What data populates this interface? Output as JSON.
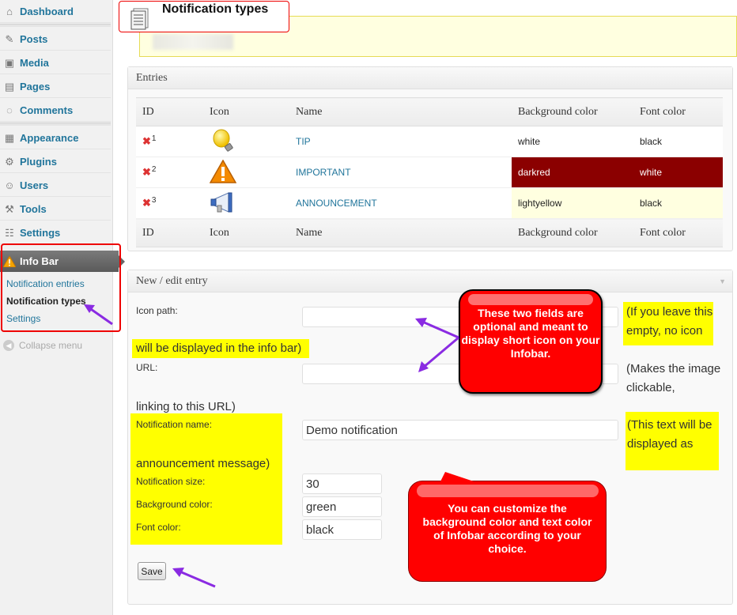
{
  "sidebar": {
    "items": [
      {
        "label": "Dashboard",
        "icon": "dashboard-icon",
        "glyph": "⌂"
      },
      {
        "label": "Posts",
        "icon": "pin-icon",
        "glyph": "✎"
      },
      {
        "label": "Media",
        "icon": "media-icon",
        "glyph": "▣"
      },
      {
        "label": "Pages",
        "icon": "pages-icon",
        "glyph": "▤"
      },
      {
        "label": "Comments",
        "icon": "comment-icon",
        "glyph": "◌"
      },
      {
        "label": "Appearance",
        "icon": "appearance-icon",
        "glyph": "▦"
      },
      {
        "label": "Plugins",
        "icon": "plugin-icon",
        "glyph": "⚙"
      },
      {
        "label": "Users",
        "icon": "users-icon",
        "glyph": "☺"
      },
      {
        "label": "Tools",
        "icon": "tools-icon",
        "glyph": "⚒"
      },
      {
        "label": "Settings",
        "icon": "settings-icon",
        "glyph": "☷"
      }
    ],
    "infobar": {
      "label": "Info Bar",
      "submenu": [
        "Notification entries",
        "Notification types",
        "Settings"
      ]
    },
    "collapse_label": "Collapse menu"
  },
  "header": {
    "title": "Notification types"
  },
  "entries": {
    "title": "Entries",
    "columns": [
      "ID",
      "Icon",
      "Name",
      "Background color",
      "Font color"
    ],
    "rows": [
      {
        "id": "1",
        "icon": "lightbulb-icon",
        "name": "TIP",
        "bg": "white",
        "font": "black",
        "bg_hex": "#ffffff",
        "fg_hex": "#222222"
      },
      {
        "id": "2",
        "icon": "warning-icon",
        "name": "IMPORTANT",
        "bg": "darkred",
        "font": "white",
        "bg_hex": "#8b0000",
        "fg_hex": "#ffffff"
      },
      {
        "id": "3",
        "icon": "megaphone-icon",
        "name": "ANNOUNCEMENT",
        "bg": "lightyellow",
        "font": "black",
        "bg_hex": "#ffffe0",
        "fg_hex": "#222222"
      }
    ]
  },
  "edit": {
    "title": "New / edit entry",
    "icon_path_label": "Icon path:",
    "icon_path_value": "",
    "icon_path_note_a": "(If you leave this empty, no icon",
    "icon_path_note_b": "will be displayed in the info bar)",
    "url_label": "URL:",
    "url_value": "",
    "url_note_a": "(Makes the image clickable,",
    "url_note_b": "linking to this URL)",
    "name_label": "Notification name:",
    "name_value": "Demo notification",
    "name_note_a": "(This text will be displayed as",
    "name_note_b": "announcement message)",
    "size_label": "Notification size:",
    "size_value": "30",
    "bg_label": "Background color:",
    "bg_value": "green",
    "font_label": "Font color:",
    "font_value": "black",
    "save_label": "Save"
  },
  "callouts": {
    "optional_fields": "These two fields are optional and meant to display short icon on your Infobar.",
    "customize": "You can customize the background color and text color of Infobar according to your choice."
  },
  "colors": {
    "link": "#21759b",
    "highlight": "#ffff00",
    "callout": "#ff0000",
    "arrow": "#8a2be2"
  }
}
